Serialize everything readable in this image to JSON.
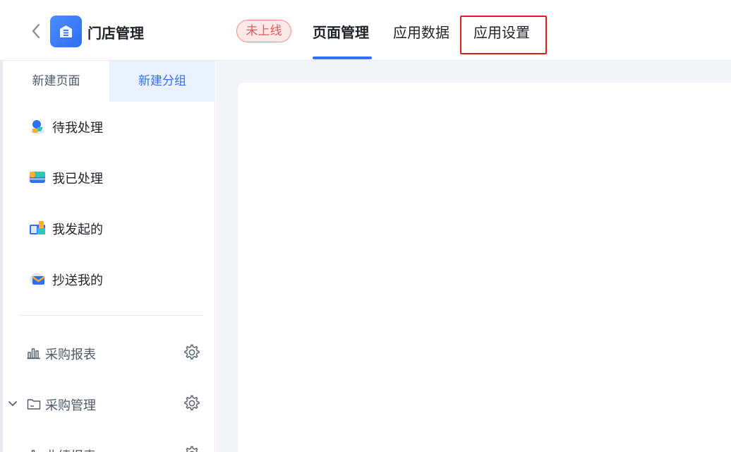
{
  "header": {
    "app_name": "门店管理",
    "status": "未上线",
    "tabs": [
      {
        "label": "页面管理",
        "active": true
      },
      {
        "label": "应用数据",
        "active": false
      },
      {
        "label": "应用设置",
        "active": false
      }
    ]
  },
  "sidebar": {
    "tabs": [
      {
        "label": "新建页面"
      },
      {
        "label": "新建分组"
      }
    ],
    "items": [
      {
        "label": "待我处理",
        "icon": "pending-icon"
      },
      {
        "label": "我已处理",
        "icon": "processed-icon"
      },
      {
        "label": "我发起的",
        "icon": "initiated-icon"
      },
      {
        "label": "抄送我的",
        "icon": "cc-mail-icon"
      }
    ],
    "groups": [
      {
        "label": "采购报表",
        "icon": "bar-chart-icon"
      },
      {
        "label": "采购管理",
        "icon": "folder-icon"
      },
      {
        "label": "业绩报表",
        "icon": "bar-chart-icon"
      }
    ]
  },
  "colors": {
    "accent": "#3370ff",
    "status_red": "#e25c5c",
    "highlight": "#e21c1c"
  }
}
